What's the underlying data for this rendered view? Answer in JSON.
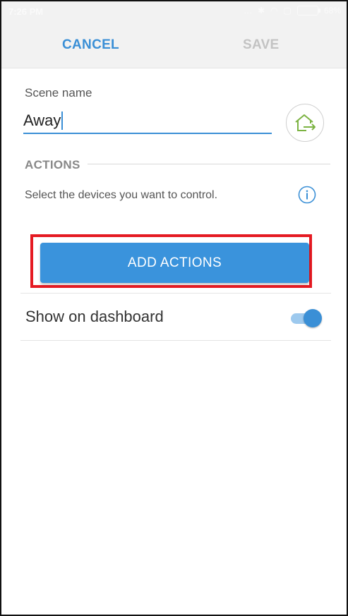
{
  "status_bar": {
    "time": "7:26 PM",
    "battery": "68%"
  },
  "app_bar": {
    "cancel_label": "CANCEL",
    "save_label": "SAVE"
  },
  "scene": {
    "name_label": "Scene name",
    "name_value": "Away"
  },
  "actions": {
    "heading": "ACTIONS",
    "description": "Select the devices you want to control.",
    "add_button_label": "ADD ACTIONS"
  },
  "dashboard": {
    "label": "Show on dashboard",
    "enabled": true
  },
  "colors": {
    "accent": "#3a8fd6",
    "highlight": "#e51a22",
    "icon_green": "#7cb342"
  },
  "icons": {
    "home_exit": "home-exit-icon",
    "info": "info-icon"
  }
}
